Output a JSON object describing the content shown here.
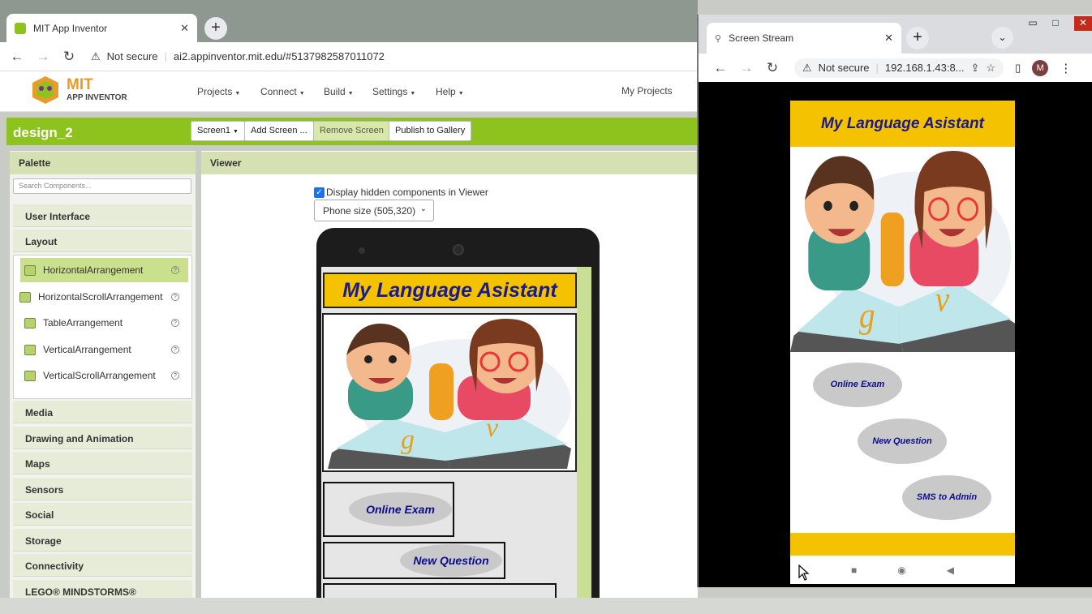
{
  "main_browser": {
    "tab_title": "MIT App Inventor",
    "url_warning": "Not secure",
    "url": "ai2.appinventor.mit.edu/#5137982587011072"
  },
  "app": {
    "logo_line1": "MIT",
    "logo_line2": "APP INVENTOR",
    "menus": [
      "Projects",
      "Connect",
      "Build",
      "Settings",
      "Help"
    ],
    "my_projects": "My Projects",
    "project_name": "design_2",
    "screen_select": "Screen1",
    "buttons": {
      "add_screen": "Add Screen ...",
      "remove_screen": "Remove Screen",
      "publish": "Publish to Gallery"
    }
  },
  "palette": {
    "title": "Palette",
    "search_placeholder": "Search Components...",
    "categories_top": [
      "User Interface",
      "Layout"
    ],
    "layout_items": [
      "HorizontalArrangement",
      "HorizontalScrollArrangement",
      "TableArrangement",
      "VerticalArrangement",
      "VerticalScrollArrangement"
    ],
    "categories_bottom": [
      "Media",
      "Drawing and Animation",
      "Maps",
      "Sensors",
      "Social",
      "Storage",
      "Connectivity",
      "LEGO® MINDSTORMS®"
    ]
  },
  "viewer": {
    "title": "Viewer",
    "display_hidden_label": "Display hidden components in Viewer",
    "display_hidden_checked": true,
    "phone_size": "Phone size (505,320)",
    "app_title": "My Language Asistant",
    "buttons": [
      "Online Exam",
      "New Question"
    ]
  },
  "stream_window": {
    "tab_title": "Screen Stream",
    "url_warning": "Not secure",
    "url": "192.168.1.43:8...",
    "avatar_letter": "M",
    "app_title": "My Language Asistant",
    "buttons": [
      "Online Exam",
      "New Question",
      "SMS to Admin"
    ]
  },
  "colors": {
    "app_green": "#8dc21f",
    "title_yellow": "#f5c200",
    "title_text": "#1a1a8a"
  }
}
